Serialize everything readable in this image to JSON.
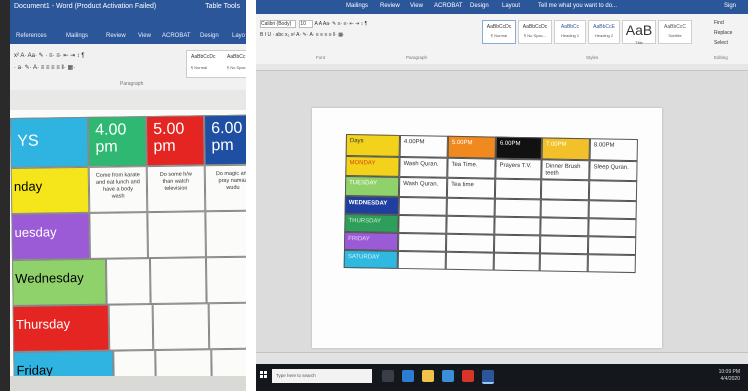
{
  "left_photo": {
    "window_title": "Document1 - Word (Product Activation Failed)",
    "table_tools": "Table Tools",
    "tabs": [
      "References",
      "Mailings",
      "Review",
      "View",
      "ACROBAT",
      "Design",
      "Layo"
    ],
    "group_paragraph": "Paragraph",
    "styles": [
      "AaBbCcDc",
      "AaBbCc"
    ],
    "style_names": [
      "¶ Normal",
      "¶ No Spac"
    ],
    "time_headers": [
      "YS",
      "4.00 pm",
      "5.00 pm",
      "6.00 pm"
    ],
    "day_labels": [
      "nday",
      "uesday",
      "Wednesday",
      "Thursday",
      "Friday"
    ],
    "monday_cells": [
      "Come from karate and eat lunch and have a body wash",
      "Do some h/w than watch television",
      "Do magic and pray namaz wudu"
    ],
    "colors": {
      "header_days": "#2fb3e0",
      "header_4pm": "#2eb872",
      "header_5pm": "#e52521",
      "header_6pm": "#1f4fa3",
      "monday": "#f5e51b",
      "tuesday": "#9b5bd6",
      "wednesday": "#8fd16a",
      "thursday": "#e52521",
      "friday": "#2fb3e0"
    }
  },
  "right_photo": {
    "title_bar": [
      "Mailings",
      "Review",
      "View",
      "ACROBAT",
      "Design",
      "Layout",
      "Tell me what you want to do...",
      "Sign"
    ],
    "font_name": "Calibri (Body)",
    "font_size": "10",
    "styles": [
      {
        "preview": "AaBbCcDc",
        "name": "¶ Normal"
      },
      {
        "preview": "AaBbCcDc",
        "name": "¶ No Spac..."
      },
      {
        "preview": "AaBbCc",
        "name": "Heading 1"
      },
      {
        "preview": "AaBbCcE",
        "name": "Heading 2"
      },
      {
        "preview": "AaB",
        "name": "Title"
      },
      {
        "preview": "AaBbCcC",
        "name": "Subtitle"
      }
    ],
    "editing": [
      "Find",
      "Replace",
      "Select"
    ],
    "groups": [
      "Font",
      "Paragraph",
      "Styles",
      "Editing"
    ],
    "table_headers": [
      "Days",
      "4.00PM",
      "5.00PM",
      "6.00PM",
      "7.00PM",
      "8.00PM"
    ],
    "table_rows": [
      {
        "day": "MONDAY",
        "cells": [
          "Wash Quran.",
          "Tea Time.",
          "Prayers T.V.",
          "Dinner Brush teeth",
          "Sleep Quran."
        ]
      },
      {
        "day": "TUESDAY",
        "cells": [
          "Wash Quran.",
          "Tea time",
          "",
          "",
          ""
        ]
      },
      {
        "day": "WEDNESDAY",
        "cells": [
          "",
          "",
          "",
          "",
          ""
        ]
      },
      {
        "day": "THURSDAY",
        "cells": [
          "",
          "",
          "",
          "",
          ""
        ]
      },
      {
        "day": "FRIDAY",
        "cells": [
          "",
          "",
          "",
          "",
          ""
        ]
      },
      {
        "day": "SATURDAY",
        "cells": [
          "",
          "",
          "",
          "",
          ""
        ]
      }
    ],
    "colors": {
      "days": "#f2d21b",
      "h5": "#f08a1f",
      "h6": "#111111",
      "h7": "#f2c12a",
      "monday": "#f2d21b",
      "tuesday": "#8fd16a",
      "wednesday": "#1f3fa0",
      "thursday": "#2e9e5b",
      "friday": "#9b5bd6",
      "saturday": "#2fb8e0"
    },
    "taskbar_search": "Type here to search",
    "clock": [
      "10:09 PM",
      "4/4/2020"
    ]
  }
}
